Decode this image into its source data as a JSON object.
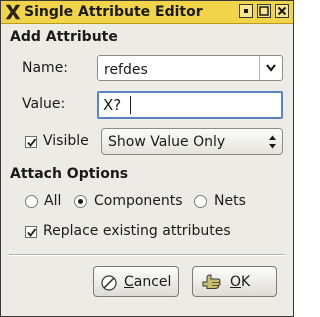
{
  "window": {
    "title": "Single Attribute Editor",
    "title_bar_color": "#f2d44a"
  },
  "add_attribute": {
    "heading": "Add Attribute",
    "name_label": "Name:",
    "name_value": "refdes",
    "value_label": "Value:",
    "value_text": "X?",
    "visible_label": "Visible",
    "visible_checked": true,
    "visibility_mode": "Show Value Only"
  },
  "attach_options": {
    "heading": "Attach Options",
    "options": [
      {
        "label": "All",
        "selected": false
      },
      {
        "label": "Components",
        "selected": true
      },
      {
        "label": "Nets",
        "selected": false
      }
    ],
    "replace_label": "Replace existing attributes",
    "replace_checked": true
  },
  "buttons": {
    "cancel_mnemonic": "C",
    "cancel_rest": "ancel",
    "ok_mnemonic": "O",
    "ok_rest": "K"
  },
  "icons": {
    "app": "x-app-icon",
    "title_buttons": [
      "iconify-icon",
      "maximize-icon",
      "close-icon"
    ],
    "cancel": "cancel-icon",
    "ok": "ok-hand-icon"
  }
}
